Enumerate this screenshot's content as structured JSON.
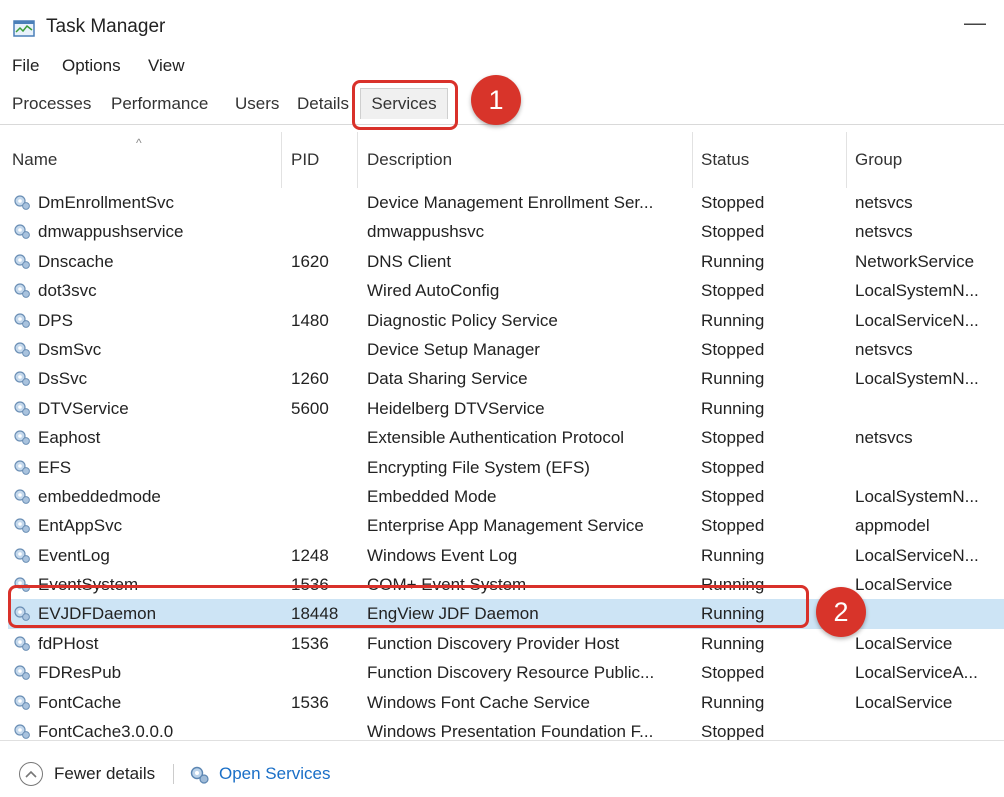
{
  "window": {
    "title": "Task Manager",
    "minimize_glyph": "—"
  },
  "menu": [
    "File",
    "Options",
    "View"
  ],
  "tabs": [
    "Processes",
    "Performance",
    "Users",
    "Details",
    "Services"
  ],
  "active_tab": "Services",
  "annotations": [
    {
      "number": "1",
      "target": "Services tab",
      "color": "#d8342a"
    },
    {
      "number": "2",
      "target": "EVJDFDaemon row",
      "color": "#d8342a"
    }
  ],
  "columns": [
    "Name",
    "PID",
    "Description",
    "Status",
    "Group"
  ],
  "sort_indicator": "^",
  "rows": [
    {
      "name": "DmEnrollmentSvc",
      "pid": "",
      "description": "Device Management Enrollment Ser...",
      "status": "Stopped",
      "group": "netsvcs"
    },
    {
      "name": "dmwappushservice",
      "pid": "",
      "description": "dmwappushsvc",
      "status": "Stopped",
      "group": "netsvcs"
    },
    {
      "name": "Dnscache",
      "pid": "1620",
      "description": "DNS Client",
      "status": "Running",
      "group": "NetworkService"
    },
    {
      "name": "dot3svc",
      "pid": "",
      "description": "Wired AutoConfig",
      "status": "Stopped",
      "group": "LocalSystemN..."
    },
    {
      "name": "DPS",
      "pid": "1480",
      "description": "Diagnostic Policy Service",
      "status": "Running",
      "group": "LocalServiceN..."
    },
    {
      "name": "DsmSvc",
      "pid": "",
      "description": "Device Setup Manager",
      "status": "Stopped",
      "group": "netsvcs"
    },
    {
      "name": "DsSvc",
      "pid": "1260",
      "description": "Data Sharing Service",
      "status": "Running",
      "group": "LocalSystemN..."
    },
    {
      "name": "DTVService",
      "pid": "5600",
      "description": "Heidelberg DTVService",
      "status": "Running",
      "group": ""
    },
    {
      "name": "Eaphost",
      "pid": "",
      "description": "Extensible Authentication Protocol",
      "status": "Stopped",
      "group": "netsvcs"
    },
    {
      "name": "EFS",
      "pid": "",
      "description": "Encrypting File System (EFS)",
      "status": "Stopped",
      "group": ""
    },
    {
      "name": "embeddedmode",
      "pid": "",
      "description": "Embedded Mode",
      "status": "Stopped",
      "group": "LocalSystemN..."
    },
    {
      "name": "EntAppSvc",
      "pid": "",
      "description": "Enterprise App Management Service",
      "status": "Stopped",
      "group": "appmodel"
    },
    {
      "name": "EventLog",
      "pid": "1248",
      "description": "Windows Event Log",
      "status": "Running",
      "group": "LocalServiceN..."
    },
    {
      "name": "EventSystem",
      "pid": "1536",
      "description": "COM+ Event System",
      "status": "Running",
      "group": "LocalService"
    },
    {
      "name": "EVJDFDaemon",
      "pid": "18448",
      "description": "EngView JDF Daemon",
      "status": "Running",
      "group": "",
      "selected": true
    },
    {
      "name": "fdPHost",
      "pid": "1536",
      "description": "Function Discovery Provider Host",
      "status": "Running",
      "group": "LocalService"
    },
    {
      "name": "FDResPub",
      "pid": "",
      "description": "Function Discovery Resource Public...",
      "status": "Stopped",
      "group": "LocalServiceA..."
    },
    {
      "name": "FontCache",
      "pid": "1536",
      "description": "Windows Font Cache Service",
      "status": "Running",
      "group": "LocalService"
    },
    {
      "name": "FontCache3.0.0.0",
      "pid": "",
      "description": "Windows Presentation Foundation F...",
      "status": "Stopped",
      "group": ""
    }
  ],
  "footer": {
    "fewer_details": "Fewer details",
    "open_services": "Open Services"
  },
  "colors": {
    "selection": "#cde4f5",
    "callout": "#d8342a",
    "link": "#1a6fc7"
  }
}
